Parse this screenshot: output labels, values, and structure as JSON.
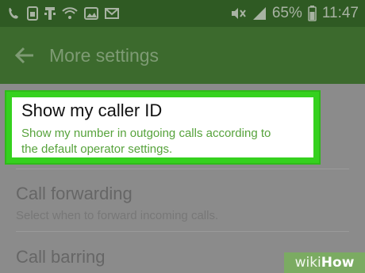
{
  "status_bar": {
    "left_icons": [
      "wifi-calling-icon",
      "sim-icon",
      "t-mobile-icon",
      "wifi-icon",
      "image-icon",
      "email-icon"
    ],
    "right_icons": [
      "mute-icon",
      "signal-icon",
      "battery-icon"
    ],
    "battery": "65%",
    "time": "11:47"
  },
  "app_bar": {
    "back_icon": "arrow-left-icon",
    "title": "More settings"
  },
  "settings": {
    "items": [
      {
        "title": "Show my caller ID",
        "subtitle_line1": "Show my number in outgoing calls according to",
        "subtitle_line2": "the default operator settings."
      },
      {
        "title": "Call forwarding",
        "subtitle": "Select when to forward incoming calls."
      },
      {
        "title": "Call barring"
      }
    ]
  },
  "watermark": {
    "part1": "wiki",
    "part2": "How"
  },
  "colors": {
    "status_bar": "#2f5a23",
    "app_bar": "#3c6a2d",
    "highlight_border": "#35d11e",
    "highlight_subtitle": "#57a33c"
  }
}
